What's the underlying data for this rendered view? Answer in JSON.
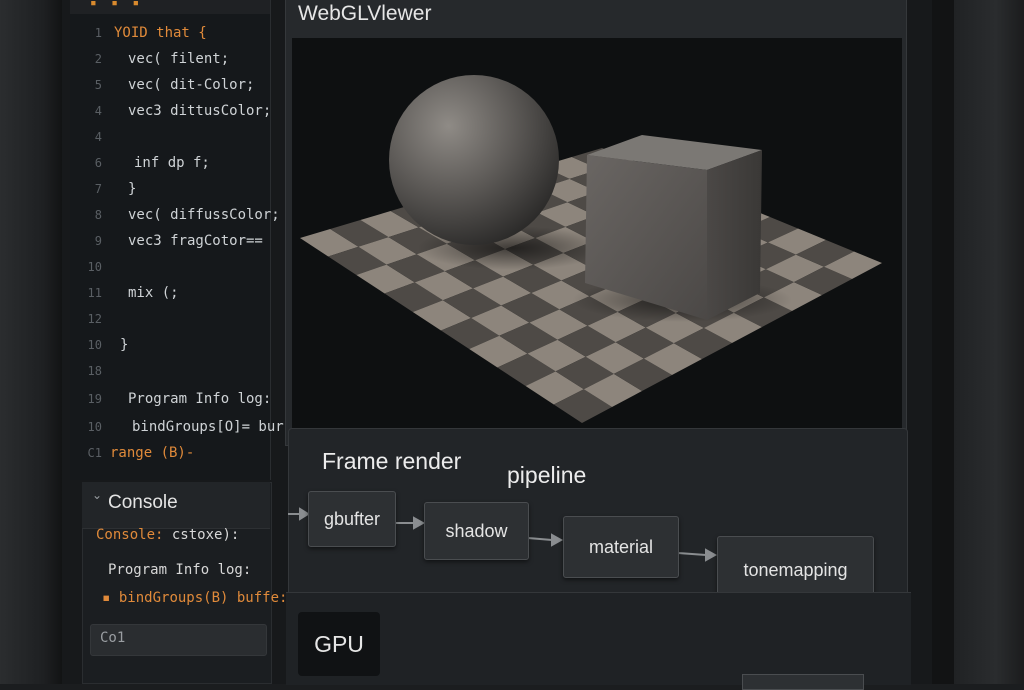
{
  "editor": {
    "tab_marks": "▪ ▪ ▪",
    "lines": [
      {
        "n": "1",
        "text": "YOID that {",
        "kw": true
      },
      {
        "n": "2",
        "text": "vec( filent;",
        "kw": false
      },
      {
        "n": "5",
        "text": "vec( dit-Color;",
        "kw": false
      },
      {
        "n": "4",
        "text": "vec3 dittusColor;",
        "kw": false
      },
      {
        "n": "4",
        "text": "",
        "kw": false
      },
      {
        "n": "6",
        "text": "inf dp f;",
        "kw": false
      },
      {
        "n": "7",
        "text": "}",
        "kw": false
      },
      {
        "n": "8",
        "text": "vec( diffussColor;",
        "kw": false
      },
      {
        "n": "9",
        "text": "vec3 fragCotor==",
        "kw": false
      },
      {
        "n": "10",
        "text": "",
        "kw": false
      },
      {
        "n": "11",
        "text": "mix (;",
        "kw": false
      },
      {
        "n": "12",
        "text": "",
        "kw": false
      },
      {
        "n": "10",
        "text": "}",
        "kw": false
      },
      {
        "n": "18",
        "text": "",
        "kw": false
      },
      {
        "n": "19",
        "text": "Program Info log:",
        "kw": false
      },
      {
        "n": "10",
        "text": "bindGroups[O]= bur",
        "kw": false
      },
      {
        "n": "C1",
        "text": "range (B)-",
        "kw": true
      }
    ]
  },
  "console": {
    "title": "Console",
    "caret": "⌄",
    "lines": [
      {
        "prefix": "Console:",
        "text": " cstoxe):"
      },
      {
        "prefix": "",
        "text": "Program Info log:"
      },
      {
        "prefix": "▪",
        "text": " bindGroups(B) buffe:"
      }
    ],
    "input_value": "Co1"
  },
  "viewer": {
    "title": "WebGLVlewer"
  },
  "pipeline": {
    "title_left": "Frame render",
    "title_right": "pipeline",
    "stages": [
      "gbufter",
      "shadow",
      "material",
      "tonemapping"
    ]
  },
  "gpu": {
    "label": "GPU"
  },
  "colors": {
    "keyword": "#e08a3a",
    "background": "#17191b",
    "panel": "#222528"
  }
}
